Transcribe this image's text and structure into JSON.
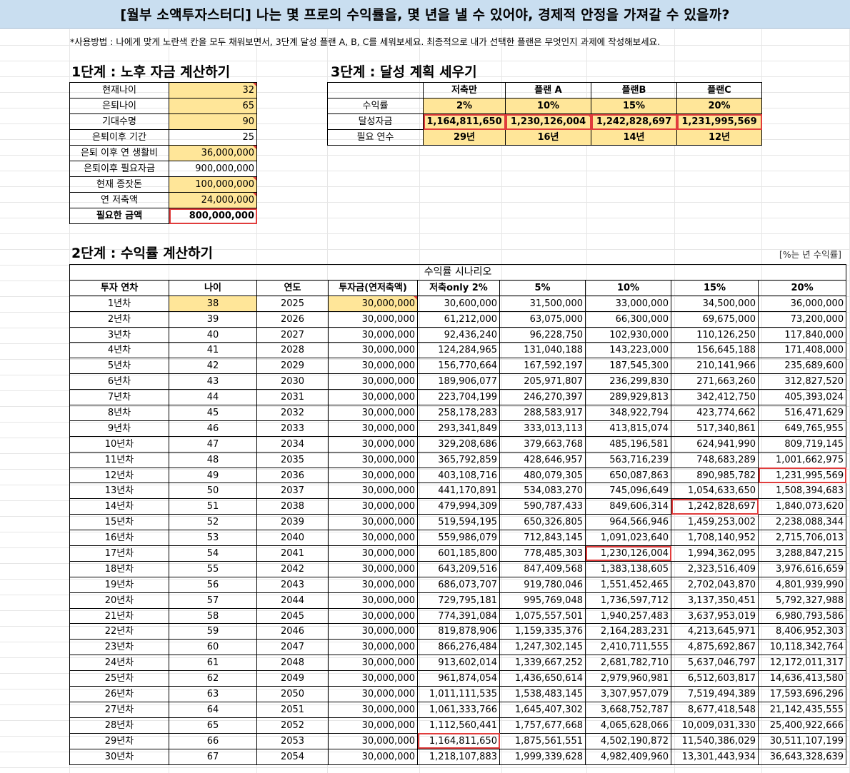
{
  "title": "[월부 소액투자스터디] 나는 몇 프로의 수익률을, 몇 년을 낼 수 있어야, 경제적 안정을 가져갈 수 있을까?",
  "usage": "*사용방법 : 나에게 맞게 노란색 칸을 모두 채워보면서, 3단계 달성 플랜 A, B, C를 세워보세요. 최종적으로 내가 선택한 플랜은 무엇인지 과제에 작성해보세요.",
  "step1": {
    "heading": "1단계 : 노후 자금 계산하기",
    "rows": [
      {
        "label": "현재나이",
        "value": "32"
      },
      {
        "label": "은퇴나이",
        "value": "65"
      },
      {
        "label": "기대수명",
        "value": "90"
      },
      {
        "label": "은퇴이후 기간",
        "value": "25"
      },
      {
        "label": "은퇴 이후 연 생활비",
        "value": "36,000,000"
      },
      {
        "label": "은퇴이후 필요자금",
        "value": "900,000,000"
      },
      {
        "label": "현재 종잣돈",
        "value": "100,000,000"
      },
      {
        "label": "연 저축액",
        "value": "24,000,000"
      },
      {
        "label": "필요한 금액",
        "value": "800,000,000"
      }
    ]
  },
  "step3": {
    "heading": "3단계 : 달성 계획 세우기",
    "columns": [
      "저축만",
      "플랜 A",
      "플랜B",
      "플랜C"
    ],
    "rows": [
      {
        "label": "수익률",
        "values": [
          "2%",
          "10%",
          "15%",
          "20%"
        ]
      },
      {
        "label": "달성자금",
        "values": [
          "1,164,811,650",
          "1,230,126,004",
          "1,242,828,697",
          "1,231,995,569"
        ]
      },
      {
        "label": "필요 연수",
        "values": [
          "29년",
          "16년",
          "14년",
          "12년"
        ]
      }
    ]
  },
  "step2": {
    "heading": "2단계 : 수익률 계산하기",
    "note": "[%는 년 수익률]",
    "scenario_title": "수익률 시나리오",
    "headers": [
      "투자 연차",
      "나이",
      "연도",
      "투자금(연저축액)",
      "저축only 2%",
      "5%",
      "10%",
      "15%",
      "20%"
    ],
    "rows": [
      [
        "1년차",
        "38",
        "2025",
        "30,000,000",
        "30,600,000",
        "31,500,000",
        "33,000,000",
        "34,500,000",
        "36,000,000"
      ],
      [
        "2년차",
        "39",
        "2026",
        "30,000,000",
        "61,212,000",
        "63,075,000",
        "66,300,000",
        "69,675,000",
        "73,200,000"
      ],
      [
        "3년차",
        "40",
        "2027",
        "30,000,000",
        "92,436,240",
        "96,228,750",
        "102,930,000",
        "110,126,250",
        "117,840,000"
      ],
      [
        "4년차",
        "41",
        "2028",
        "30,000,000",
        "124,284,965",
        "131,040,188",
        "143,223,000",
        "156,645,188",
        "171,408,000"
      ],
      [
        "5년차",
        "42",
        "2029",
        "30,000,000",
        "156,770,664",
        "167,592,197",
        "187,545,300",
        "210,141,966",
        "235,689,600"
      ],
      [
        "6년차",
        "43",
        "2030",
        "30,000,000",
        "189,906,077",
        "205,971,807",
        "236,299,830",
        "271,663,260",
        "312,827,520"
      ],
      [
        "7년차",
        "44",
        "2031",
        "30,000,000",
        "223,704,199",
        "246,270,397",
        "289,929,813",
        "342,412,750",
        "405,393,024"
      ],
      [
        "8년차",
        "45",
        "2032",
        "30,000,000",
        "258,178,283",
        "288,583,917",
        "348,922,794",
        "423,774,662",
        "516,471,629"
      ],
      [
        "9년차",
        "46",
        "2033",
        "30,000,000",
        "293,341,849",
        "333,013,113",
        "413,815,074",
        "517,340,861",
        "649,765,955"
      ],
      [
        "10년차",
        "47",
        "2034",
        "30,000,000",
        "329,208,686",
        "379,663,768",
        "485,196,581",
        "624,941,990",
        "809,719,145"
      ],
      [
        "11년차",
        "48",
        "2035",
        "30,000,000",
        "365,792,859",
        "428,646,957",
        "563,716,239",
        "748,683,289",
        "1,001,662,975"
      ],
      [
        "12년차",
        "49",
        "2036",
        "30,000,000",
        "403,108,716",
        "480,079,305",
        "650,087,863",
        "890,985,782",
        "1,231,995,569"
      ],
      [
        "13년차",
        "50",
        "2037",
        "30,000,000",
        "441,170,891",
        "534,083,270",
        "745,096,649",
        "1,054,633,650",
        "1,508,394,683"
      ],
      [
        "14년차",
        "51",
        "2038",
        "30,000,000",
        "479,994,309",
        "590,787,433",
        "849,606,314",
        "1,242,828,697",
        "1,840,073,620"
      ],
      [
        "15년차",
        "52",
        "2039",
        "30,000,000",
        "519,594,195",
        "650,326,805",
        "964,566,946",
        "1,459,253,002",
        "2,238,088,344"
      ],
      [
        "16년차",
        "53",
        "2040",
        "30,000,000",
        "559,986,079",
        "712,843,145",
        "1,091,023,640",
        "1,708,140,952",
        "2,715,706,013"
      ],
      [
        "17년차",
        "54",
        "2041",
        "30,000,000",
        "601,185,800",
        "778,485,303",
        "1,230,126,004",
        "1,994,362,095",
        "3,288,847,215"
      ],
      [
        "18년차",
        "55",
        "2042",
        "30,000,000",
        "643,209,516",
        "847,409,568",
        "1,383,138,605",
        "2,323,516,409",
        "3,976,616,659"
      ],
      [
        "19년차",
        "56",
        "2043",
        "30,000,000",
        "686,073,707",
        "919,780,046",
        "1,551,452,465",
        "2,702,043,870",
        "4,801,939,990"
      ],
      [
        "20년차",
        "57",
        "2044",
        "30,000,000",
        "729,795,181",
        "995,769,048",
        "1,736,597,712",
        "3,137,350,451",
        "5,792,327,988"
      ],
      [
        "21년차",
        "58",
        "2045",
        "30,000,000",
        "774,391,084",
        "1,075,557,501",
        "1,940,257,483",
        "3,637,953,019",
        "6,980,793,586"
      ],
      [
        "22년차",
        "59",
        "2046",
        "30,000,000",
        "819,878,906",
        "1,159,335,376",
        "2,164,283,231",
        "4,213,645,971",
        "8,406,952,303"
      ],
      [
        "23년차",
        "60",
        "2047",
        "30,000,000",
        "866,276,484",
        "1,247,302,145",
        "2,410,711,555",
        "4,875,692,867",
        "10,118,342,764"
      ],
      [
        "24년차",
        "61",
        "2048",
        "30,000,000",
        "913,602,014",
        "1,339,667,252",
        "2,681,782,710",
        "5,637,046,797",
        "12,172,011,317"
      ],
      [
        "25년차",
        "62",
        "2049",
        "30,000,000",
        "961,874,054",
        "1,436,650,614",
        "2,979,960,981",
        "6,512,603,817",
        "14,636,413,580"
      ],
      [
        "26년차",
        "63",
        "2050",
        "30,000,000",
        "1,011,111,535",
        "1,538,483,145",
        "3,307,957,079",
        "7,519,494,389",
        "17,593,696,296"
      ],
      [
        "27년차",
        "64",
        "2051",
        "30,000,000",
        "1,061,333,766",
        "1,645,407,302",
        "3,668,752,787",
        "8,677,418,548",
        "21,142,435,555"
      ],
      [
        "28년차",
        "65",
        "2052",
        "30,000,000",
        "1,112,560,441",
        "1,757,677,668",
        "4,065,628,066",
        "10,009,031,330",
        "25,400,922,666"
      ],
      [
        "29년차",
        "66",
        "2053",
        "30,000,000",
        "1,164,811,650",
        "1,875,561,551",
        "4,502,190,872",
        "11,540,386,029",
        "30,511,107,199"
      ],
      [
        "30년차",
        "67",
        "2054",
        "30,000,000",
        "1,218,107,883",
        "1,999,339,628",
        "4,982,409,960",
        "13,301,443,934",
        "36,643,328,639"
      ]
    ],
    "highlighted_cells": [
      {
        "row": 28,
        "col": 4
      },
      {
        "row": 16,
        "col": 6
      },
      {
        "row": 13,
        "col": 7
      },
      {
        "row": 11,
        "col": 8
      }
    ]
  },
  "colors": {
    "input_yellow": "#ffe699",
    "title_blue": "#c9def0",
    "highlight_red": "#e03c3c"
  }
}
